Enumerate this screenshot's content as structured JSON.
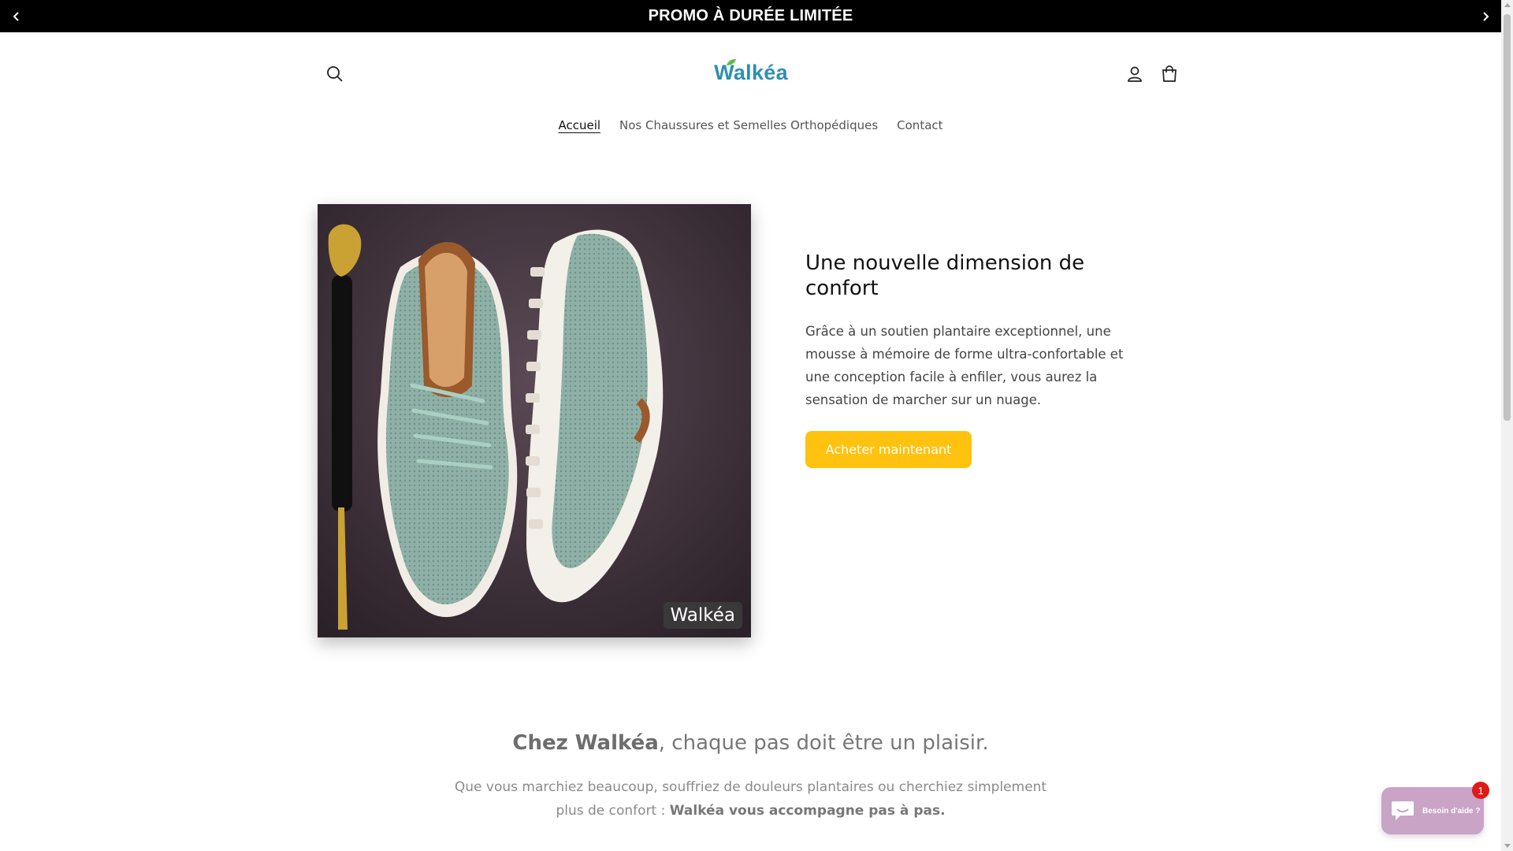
{
  "announcement": {
    "text": "PROMO À DURÉE LIMITÉE"
  },
  "header": {
    "logo_text": "Walkéa",
    "icons": [
      "search-icon",
      "account-icon",
      "cart-icon"
    ]
  },
  "nav": {
    "items": [
      {
        "label": "Accueil"
      },
      {
        "label": "Nos Chaussures et Semelles Orthopédiques"
      },
      {
        "label": "Contact"
      }
    ]
  },
  "hero": {
    "watermark": "Walkéa",
    "title": "Une nouvelle dimension de confort",
    "body": "Grâce à un soutien plantaire exceptionnel, une mousse à mémoire de forme ultra-confortable et une conception facile à enfiler, vous aurez la sensation de marcher sur un nuage.",
    "cta_label": "Acheter maintenant"
  },
  "section": {
    "title_strong": "Chez Walkéa",
    "title_rest": ", chaque pas doit être un plaisir.",
    "body_plain": "Que vous marchiez beaucoup, souffriez de douleurs plantaires ou cherchiez simplement plus de confort : ",
    "body_strong": "Walkéa vous accompagne pas à pas."
  },
  "chat": {
    "label": "Besoin d'aide ?",
    "badge": "1"
  },
  "colors": {
    "cta": "#ffc20e",
    "logo": "#2f8fb0",
    "chat": "#c9a4c7"
  }
}
